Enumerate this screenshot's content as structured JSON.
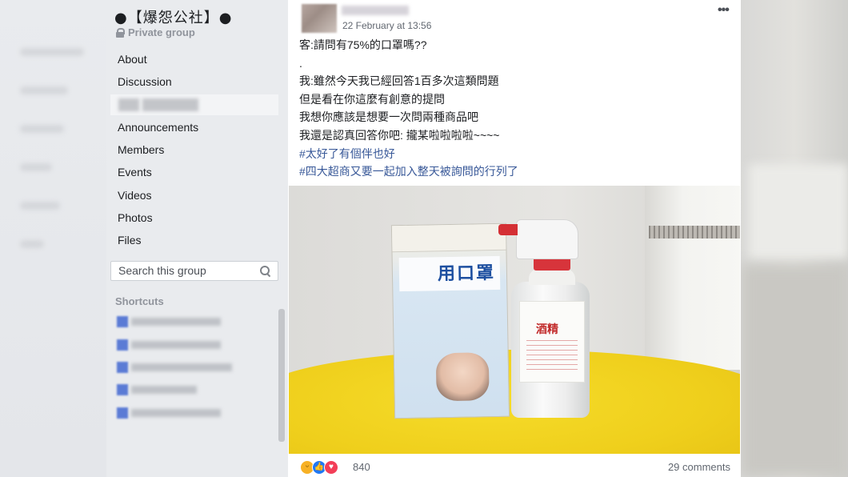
{
  "group": {
    "name": "●【爆怨公社】●",
    "privacy": "Private group"
  },
  "sidebar": {
    "items": [
      {
        "label": "About"
      },
      {
        "label": "Discussion"
      },
      {
        "label": ""
      },
      {
        "label": "Announcements"
      },
      {
        "label": "Members"
      },
      {
        "label": "Events"
      },
      {
        "label": "Videos"
      },
      {
        "label": "Photos"
      },
      {
        "label": "Files"
      }
    ],
    "search_placeholder": "Search this group",
    "shortcuts_label": "Shortcuts"
  },
  "post": {
    "timestamp": "22 February at 13:56",
    "lines": [
      "客:請問有75%的口罩嗎??",
      ".",
      "我:雖然今天我已經回答1百多次這類問題",
      "但是看在你這麼有創意的提問",
      "我想你應該是想要一次問兩種商品吧",
      "我還是認真回答你吧: 攏某啦啦啦啦~~~~"
    ],
    "hashtags": [
      "#太好了有個伴也好",
      "#四大超商又要一起加入整天被詢問的行列了"
    ],
    "photo": {
      "mask_label": "用口罩",
      "bottle_label": "酒精"
    },
    "reactions": {
      "icons": [
        "haha-icon",
        "like-icon",
        "love-icon"
      ],
      "count": "840"
    },
    "comments": "29 comments"
  }
}
